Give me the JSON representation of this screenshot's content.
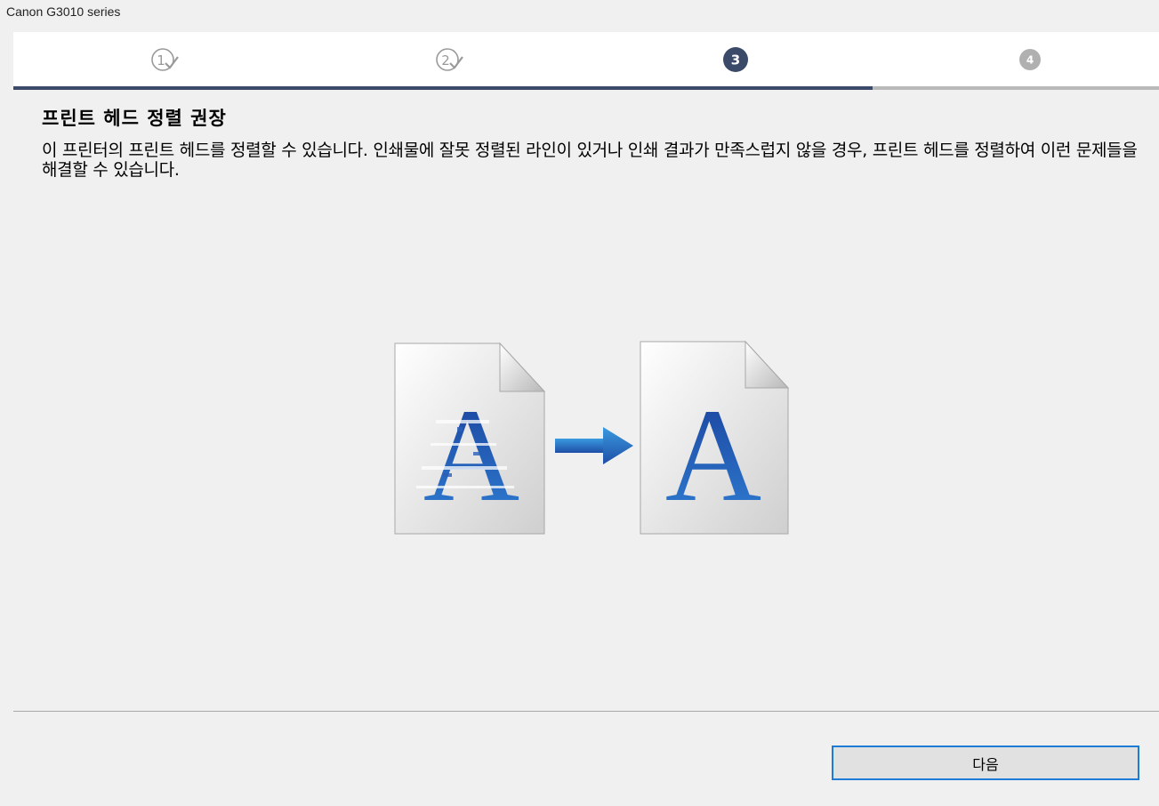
{
  "window": {
    "title": "Canon G3010 series"
  },
  "steps": [
    {
      "number": "1",
      "state": "completed"
    },
    {
      "number": "2",
      "state": "completed"
    },
    {
      "number": "3",
      "state": "current"
    },
    {
      "number": "4",
      "state": "upcoming"
    }
  ],
  "progress": {
    "current_step": 3,
    "total_steps": 4
  },
  "content": {
    "heading": "프린트 헤드 정렬 권장",
    "description": "이 프린터의 프린트 헤드를 정렬할 수 있습니다. 인쇄물에 잘못 정렬된 라인이 있거나 인쇄 결과가 만족스럽지 않을 경우, 프린트 헤드를 정렬하여 이런 문제들을 해결할 수 있습니다.",
    "illustration": {
      "before_icon": "misaligned-letter-a-document-icon",
      "arrow_icon": "right-arrow-icon",
      "after_icon": "aligned-letter-a-document-icon",
      "glyph": "A"
    }
  },
  "footer": {
    "next_label": "다음"
  },
  "colors": {
    "accent": "#3c4a69",
    "completed_step": "#9a9a9a",
    "upcoming_step": "#b0b0b0",
    "button_border": "#1e7cd6",
    "letter_blue": "#1d4fa8"
  }
}
